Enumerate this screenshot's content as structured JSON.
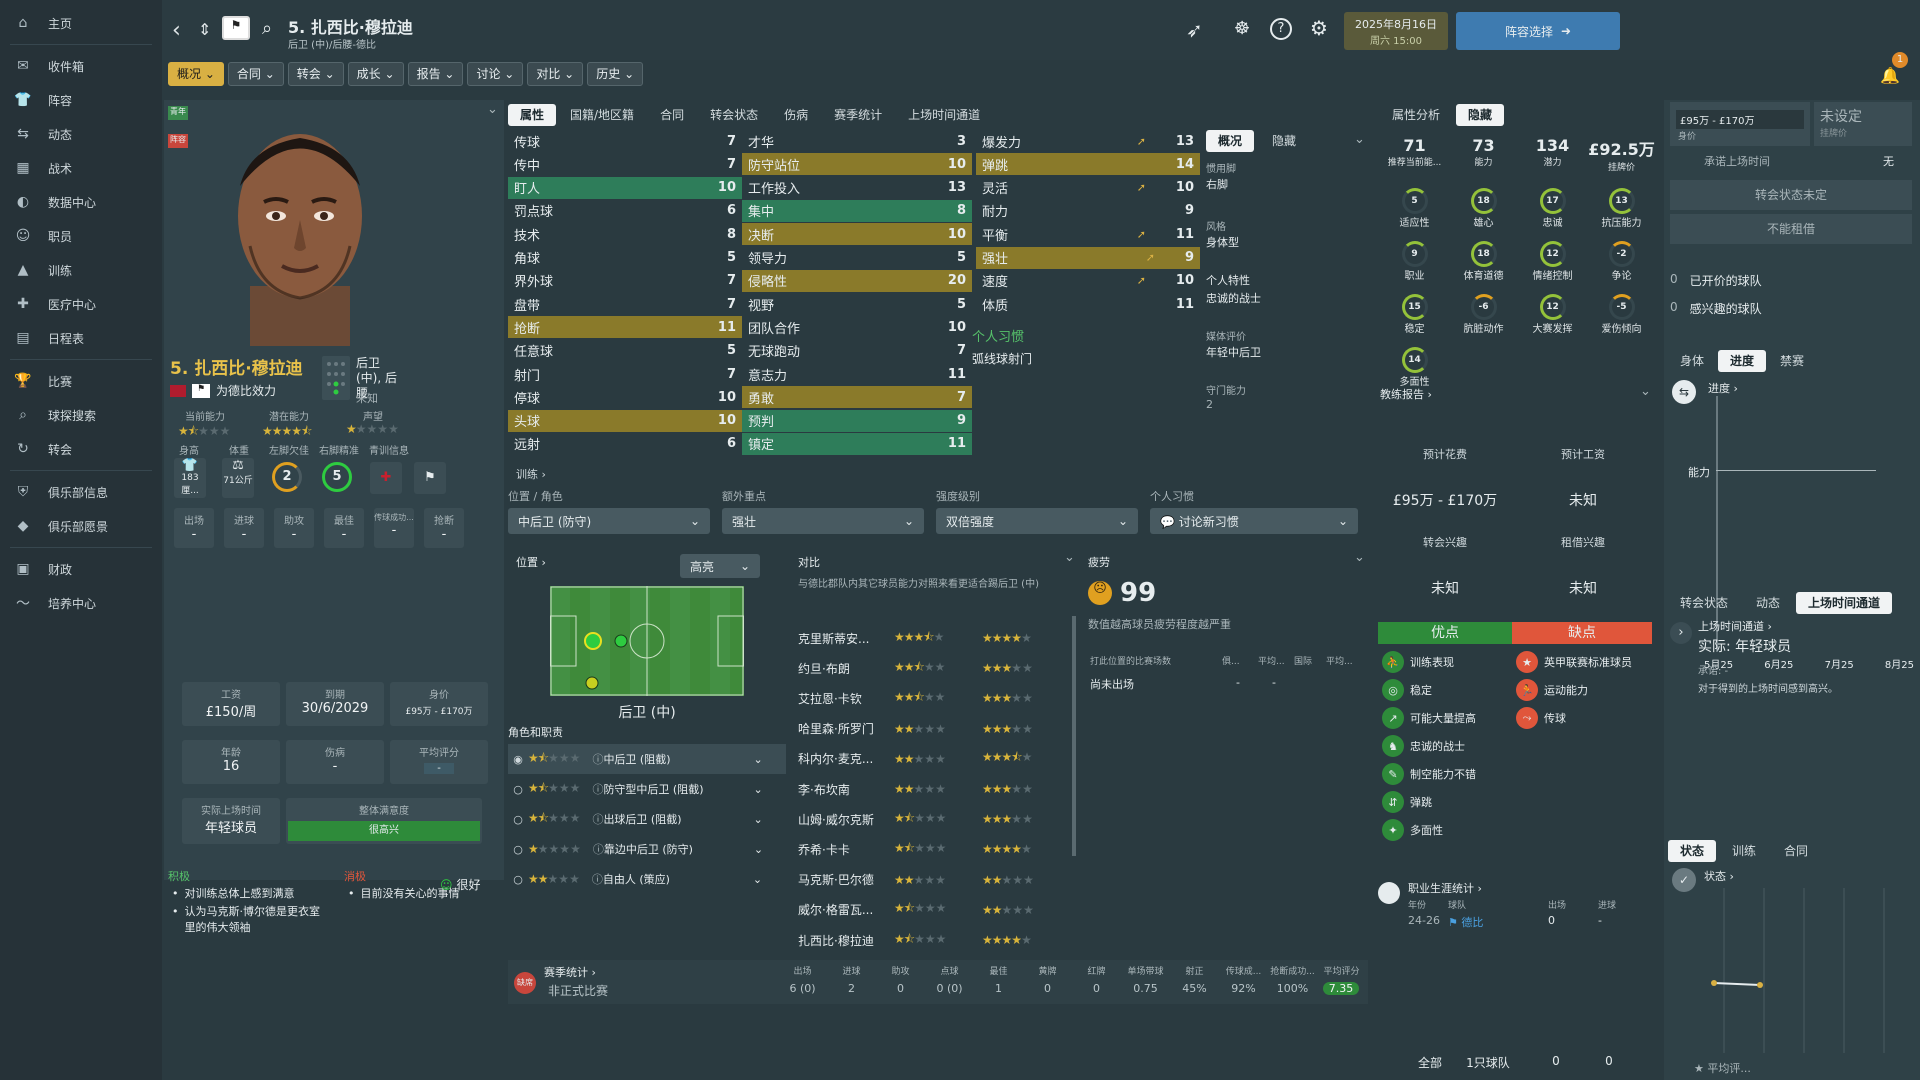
{
  "sidebar": {
    "items": [
      {
        "label": "主页",
        "icon": "home-icon",
        "glyph": "⌂"
      },
      {
        "label": "收件箱",
        "icon": "inbox-icon",
        "glyph": "✉"
      },
      {
        "label": "阵容",
        "icon": "squad-icon",
        "glyph": "👕"
      },
      {
        "label": "动态",
        "icon": "dynamics-icon",
        "glyph": "⇆"
      },
      {
        "label": "战术",
        "icon": "tactics-icon",
        "glyph": "▦"
      },
      {
        "label": "数据中心",
        "icon": "data-hub-icon",
        "glyph": "◐"
      },
      {
        "label": "职员",
        "icon": "staff-icon",
        "glyph": "☺"
      },
      {
        "label": "训练",
        "icon": "training-icon",
        "glyph": "▲"
      },
      {
        "label": "医疗中心",
        "icon": "medical-icon",
        "glyph": "✚"
      },
      {
        "label": "日程表",
        "icon": "schedule-icon",
        "glyph": "▤"
      },
      {
        "label": "比赛",
        "icon": "competitions-icon",
        "glyph": "🏆"
      },
      {
        "label": "球探搜索",
        "icon": "scouting-icon",
        "glyph": "⌕"
      },
      {
        "label": "转会",
        "icon": "transfers-icon",
        "glyph": "↻"
      },
      {
        "label": "俱乐部信息",
        "icon": "club-info-icon",
        "glyph": "⛨"
      },
      {
        "label": "俱乐部愿景",
        "icon": "club-vision-icon",
        "glyph": "◆"
      },
      {
        "label": "财政",
        "icon": "finances-icon",
        "glyph": "▣"
      },
      {
        "label": "培养中心",
        "icon": "development-icon",
        "glyph": "〜"
      }
    ]
  },
  "header": {
    "title": "5. 扎西比·穆拉迪",
    "subtitle": "后卫 (中)/后腰-德比",
    "date": "2025年8月16日",
    "day_time": "周六 15:00",
    "squad_button": "阵容选择",
    "notif_count": "1"
  },
  "crumbs": [
    "概况",
    "合同",
    "转会",
    "成长",
    "报告",
    "讨论",
    "对比",
    "历史"
  ],
  "profile": {
    "badge_youth": "青年",
    "badge_red": "阵容",
    "name": "5. 扎西比·穆拉迪",
    "club_line": "为德比效力",
    "position": "后卫 (中), 后腰",
    "pos_status": "未知",
    "ca_label": "当前能力",
    "pa_label": "潜在能力",
    "rep_label": "声望",
    "ca_stars": 1.5,
    "pa_stars": 4.5,
    "rep_stars": 1,
    "phys_labels": [
      "身高",
      "体重",
      "左脚欠佳",
      "右脚精准",
      "青训信息"
    ],
    "height": "183厘...",
    "weight": "71公斤",
    "left_foot": "2",
    "right_foot": "5",
    "stat_labels": [
      "出场",
      "进球",
      "助攻",
      "最佳",
      "传球成功...",
      "抢断"
    ],
    "stat_values": [
      "-",
      "-",
      "-",
      "-",
      "-",
      "-"
    ],
    "wage_label": "工资",
    "wage": "£150/周",
    "expire_label": "到期",
    "expire": "30/6/2029",
    "value_label": "身价",
    "value": "£95万 - £170万",
    "age_label": "年龄",
    "age": "16",
    "injury_label": "伤病",
    "injury": "-",
    "avg_label": "平均评分",
    "avg": "-",
    "playtime_label": "实际上场时间",
    "playtime": "年轻球员",
    "happy_label": "整体满意度",
    "happy": "很高兴",
    "pos_title": "积极",
    "pos_items": [
      "对训练总体上感到满意",
      "认为马克斯·博尔德是更衣室里的伟大领袖"
    ],
    "neg_title": "消极",
    "neg_items": [
      "目前没有关心的事情"
    ],
    "mood": "很好"
  },
  "attr_tabs": [
    "属性",
    "国籍/地区籍",
    "合同",
    "转会状态",
    "伤病",
    "赛季统计",
    "上场时间通道"
  ],
  "tech": [
    [
      "传球",
      "7"
    ],
    [
      "传中",
      "7"
    ],
    [
      "盯人",
      "10"
    ],
    [
      "罚点球",
      "6"
    ],
    [
      "技术",
      "8"
    ],
    [
      "角球",
      "5"
    ],
    [
      "界外球",
      "7"
    ],
    [
      "盘带",
      "7"
    ],
    [
      "抢断",
      "11"
    ],
    [
      "任意球",
      "5"
    ],
    [
      "射门",
      "7"
    ],
    [
      "停球",
      "10"
    ],
    [
      "头球",
      "10"
    ],
    [
      "远射",
      "6"
    ]
  ],
  "mental": [
    [
      "才华",
      "3"
    ],
    [
      "防守站位",
      "10"
    ],
    [
      "工作投入",
      "13"
    ],
    [
      "集中",
      "8"
    ],
    [
      "决断",
      "10"
    ],
    [
      "领导力",
      "5"
    ],
    [
      "侵略性",
      "20"
    ],
    [
      "视野",
      "5"
    ],
    [
      "团队合作",
      "10"
    ],
    [
      "无球跑动",
      "7"
    ],
    [
      "意志力",
      "11"
    ],
    [
      "勇敢",
      "7"
    ],
    [
      "预判",
      "9"
    ],
    [
      "镇定",
      "11"
    ]
  ],
  "physical": [
    [
      "爆发力",
      "13"
    ],
    [
      "弹跳",
      "14"
    ],
    [
      "灵活",
      "10"
    ],
    [
      "耐力",
      "9"
    ],
    [
      "平衡",
      "11"
    ],
    [
      "强壮",
      "9"
    ],
    [
      "速度",
      "10"
    ],
    [
      "体质",
      "11"
    ]
  ],
  "habits": {
    "title": "个人习惯",
    "item": "弧线球射门"
  },
  "side": {
    "tab1": "概况",
    "tab2": "隐藏",
    "foot_label": "惯用脚",
    "foot": "右脚",
    "style_label": "风格",
    "style": "身体型",
    "trait_label": "个人特性",
    "trait": "忠诚的战士",
    "media_label": "媒体评价",
    "media": "年轻中后卫",
    "def_label": "守门能力",
    "def": "2"
  },
  "training": {
    "title": "训练",
    "pos_label": "位置 / 角色",
    "pos_val": "中后卫 (防守)",
    "focus_label": "额外重点",
    "focus_val": "强壮",
    "intensity_label": "强度级别",
    "intensity_val": "双倍强度",
    "habit_label": "个人习惯",
    "habit_val": "讨论新习惯"
  },
  "position": {
    "title": "位置",
    "dd": "高亮",
    "label": "后卫 (中)",
    "roles_title": "角色和职责"
  },
  "roles": [
    {
      "name": "中后卫 (阻截)",
      "stars": 1.5
    },
    {
      "name": "防守型中后卫 (阻截)",
      "stars": 1.5
    },
    {
      "name": "出球后卫 (阻截)",
      "stars": 1.5
    },
    {
      "name": "靠边中后卫 (防守)",
      "stars": 1
    },
    {
      "name": "自由人 (策应)",
      "stars": 2
    }
  ],
  "compare": {
    "title": "对比",
    "desc": "与德比郡队内其它球员能力对照来看更适合踢后卫 (中)",
    "rows": [
      [
        "克里斯蒂安...",
        3.5,
        4
      ],
      [
        "约旦·布朗",
        2.5,
        3
      ],
      [
        "艾拉恩·卡钦",
        2.5,
        3
      ],
      [
        "哈里森·所罗门",
        2,
        3
      ],
      [
        "科内尔·麦克...",
        2,
        3.5
      ],
      [
        "李·布坎南",
        2,
        3
      ],
      [
        "山姆·威尔克斯",
        1.5,
        3
      ],
      [
        "乔希·卡卡",
        1.5,
        4
      ],
      [
        "马克斯·巴尔德",
        2,
        2
      ],
      [
        "威尔·格雷瓦...",
        1.5,
        2
      ],
      [
        "扎西比·穆拉迪",
        1.5,
        4
      ]
    ]
  },
  "fatigue": {
    "title": "疲劳",
    "value": "99",
    "desc": "数值越高球员疲劳程度越严重",
    "table_h": "打此位置的比赛场数",
    "cols": [
      "俱...",
      "平均...",
      "国际",
      "平均..."
    ],
    "row": "尚未出场",
    "row_vals": [
      "-",
      "-"
    ]
  },
  "stats": {
    "title": "赛季统计",
    "row": "非正式比赛",
    "cols": [
      "出场",
      "进球",
      "助攻",
      "点球",
      "最佳",
      "黄牌",
      "红牌",
      "单场带球",
      "射正",
      "传球成...",
      "抢断成功...",
      "平均评分"
    ],
    "vals": [
      "6 (0)",
      "2",
      "0",
      "0 (0)",
      "1",
      "0",
      "0",
      "0.75",
      "45%",
      "92%",
      "100%",
      "7.35"
    ],
    "badge": "缺席"
  },
  "analysis": {
    "tab1": "属性分析",
    "tab2": "隐藏",
    "nums": [
      [
        "71",
        "推荐当前能..."
      ],
      [
        "73",
        "能力"
      ],
      [
        "134",
        "潜力"
      ],
      [
        "£92.5万",
        "挂牌价"
      ]
    ],
    "gauges": [
      [
        "5",
        "适应性"
      ],
      [
        "18",
        "雄心"
      ],
      [
        "17",
        "忠诚"
      ],
      [
        "13",
        "抗压能力"
      ],
      [
        "9",
        "职业"
      ],
      [
        "18",
        "体育道德"
      ],
      [
        "12",
        "情绪控制"
      ],
      [
        "-2",
        "争论"
      ],
      [
        "15",
        "稳定"
      ],
      [
        "-6",
        "肮脏动作"
      ],
      [
        "12",
        "大赛发挥"
      ],
      [
        "-5",
        "爱伤倾向"
      ],
      [
        "14",
        "多面性"
      ]
    ],
    "coach": "教练报告",
    "fee_label": "预计花费",
    "fee": "£95万 - £170万",
    "wage_label": "预计工资",
    "wage": "未知",
    "tr_label": "转会兴趣",
    "tr": "未知",
    "loan_label": "租借兴趣",
    "loan": "未知",
    "pros_title": "优点",
    "cons_title": "缺点",
    "pros": [
      "训练表现",
      "稳定",
      "可能大量提高",
      "忠诚的战士",
      "制空能力不错",
      "弹跳",
      "多面性"
    ],
    "cons": [
      "英甲联赛标准球员",
      "运动能力",
      "传球"
    ],
    "career": "职业生涯统计",
    "career_cols": [
      "年份",
      "球队",
      "出场",
      "进球"
    ],
    "career_row": [
      "24-26",
      "德比",
      "0",
      "-"
    ],
    "career_total": [
      "全部",
      "1只球队",
      "0",
      "0"
    ]
  },
  "right": {
    "value_range": "£95万 - £170万",
    "value_lbl": "身价",
    "price": "未设定",
    "price_lbl": "挂牌价",
    "promise": "承诺上场时间",
    "promise_v": "无",
    "tstatus": "转会状态未定",
    "loan": "不能租借",
    "open_clubs": "已开价的球队",
    "open_n": "0",
    "int_clubs": "感兴趣的球队",
    "int_n": "0",
    "dev_tabs": [
      "身体",
      "进度",
      "禁赛"
    ],
    "dev_title": "进度",
    "dev_axis": "能力",
    "dev_months": [
      "5月25",
      "6月25",
      "7月25",
      "8月25"
    ],
    "st_tabs": [
      "转会状态",
      "动态",
      "上场时间通道"
    ],
    "pt_title": "上场时间通道",
    "pt_value": "实际: 年轻球员",
    "pt_promise": "承诺: -",
    "pt_desc": "对于得到的上场时间感到高兴。",
    "bt_tabs": [
      "状态",
      "训练",
      "合同"
    ],
    "bt_title": "状态",
    "bt_foot": "平均评..."
  },
  "colors": {
    "accent": "#d9b043",
    "green": "#2e8b3a",
    "red": "#e0563b"
  }
}
